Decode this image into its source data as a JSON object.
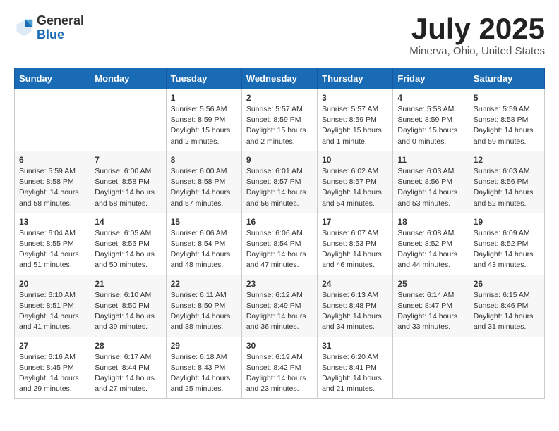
{
  "header": {
    "logo_general": "General",
    "logo_blue": "Blue",
    "month_title": "July 2025",
    "location": "Minerva, Ohio, United States"
  },
  "weekdays": [
    "Sunday",
    "Monday",
    "Tuesday",
    "Wednesday",
    "Thursday",
    "Friday",
    "Saturday"
  ],
  "weeks": [
    [
      {
        "day": "",
        "info": ""
      },
      {
        "day": "",
        "info": ""
      },
      {
        "day": "1",
        "info": "Sunrise: 5:56 AM\nSunset: 8:59 PM\nDaylight: 15 hours and 2 minutes."
      },
      {
        "day": "2",
        "info": "Sunrise: 5:57 AM\nSunset: 8:59 PM\nDaylight: 15 hours and 2 minutes."
      },
      {
        "day": "3",
        "info": "Sunrise: 5:57 AM\nSunset: 8:59 PM\nDaylight: 15 hours and 1 minute."
      },
      {
        "day": "4",
        "info": "Sunrise: 5:58 AM\nSunset: 8:59 PM\nDaylight: 15 hours and 0 minutes."
      },
      {
        "day": "5",
        "info": "Sunrise: 5:59 AM\nSunset: 8:58 PM\nDaylight: 14 hours and 59 minutes."
      }
    ],
    [
      {
        "day": "6",
        "info": "Sunrise: 5:59 AM\nSunset: 8:58 PM\nDaylight: 14 hours and 58 minutes."
      },
      {
        "day": "7",
        "info": "Sunrise: 6:00 AM\nSunset: 8:58 PM\nDaylight: 14 hours and 58 minutes."
      },
      {
        "day": "8",
        "info": "Sunrise: 6:00 AM\nSunset: 8:58 PM\nDaylight: 14 hours and 57 minutes."
      },
      {
        "day": "9",
        "info": "Sunrise: 6:01 AM\nSunset: 8:57 PM\nDaylight: 14 hours and 56 minutes."
      },
      {
        "day": "10",
        "info": "Sunrise: 6:02 AM\nSunset: 8:57 PM\nDaylight: 14 hours and 54 minutes."
      },
      {
        "day": "11",
        "info": "Sunrise: 6:03 AM\nSunset: 8:56 PM\nDaylight: 14 hours and 53 minutes."
      },
      {
        "day": "12",
        "info": "Sunrise: 6:03 AM\nSunset: 8:56 PM\nDaylight: 14 hours and 52 minutes."
      }
    ],
    [
      {
        "day": "13",
        "info": "Sunrise: 6:04 AM\nSunset: 8:55 PM\nDaylight: 14 hours and 51 minutes."
      },
      {
        "day": "14",
        "info": "Sunrise: 6:05 AM\nSunset: 8:55 PM\nDaylight: 14 hours and 50 minutes."
      },
      {
        "day": "15",
        "info": "Sunrise: 6:06 AM\nSunset: 8:54 PM\nDaylight: 14 hours and 48 minutes."
      },
      {
        "day": "16",
        "info": "Sunrise: 6:06 AM\nSunset: 8:54 PM\nDaylight: 14 hours and 47 minutes."
      },
      {
        "day": "17",
        "info": "Sunrise: 6:07 AM\nSunset: 8:53 PM\nDaylight: 14 hours and 46 minutes."
      },
      {
        "day": "18",
        "info": "Sunrise: 6:08 AM\nSunset: 8:52 PM\nDaylight: 14 hours and 44 minutes."
      },
      {
        "day": "19",
        "info": "Sunrise: 6:09 AM\nSunset: 8:52 PM\nDaylight: 14 hours and 43 minutes."
      }
    ],
    [
      {
        "day": "20",
        "info": "Sunrise: 6:10 AM\nSunset: 8:51 PM\nDaylight: 14 hours and 41 minutes."
      },
      {
        "day": "21",
        "info": "Sunrise: 6:10 AM\nSunset: 8:50 PM\nDaylight: 14 hours and 39 minutes."
      },
      {
        "day": "22",
        "info": "Sunrise: 6:11 AM\nSunset: 8:50 PM\nDaylight: 14 hours and 38 minutes."
      },
      {
        "day": "23",
        "info": "Sunrise: 6:12 AM\nSunset: 8:49 PM\nDaylight: 14 hours and 36 minutes."
      },
      {
        "day": "24",
        "info": "Sunrise: 6:13 AM\nSunset: 8:48 PM\nDaylight: 14 hours and 34 minutes."
      },
      {
        "day": "25",
        "info": "Sunrise: 6:14 AM\nSunset: 8:47 PM\nDaylight: 14 hours and 33 minutes."
      },
      {
        "day": "26",
        "info": "Sunrise: 6:15 AM\nSunset: 8:46 PM\nDaylight: 14 hours and 31 minutes."
      }
    ],
    [
      {
        "day": "27",
        "info": "Sunrise: 6:16 AM\nSunset: 8:45 PM\nDaylight: 14 hours and 29 minutes."
      },
      {
        "day": "28",
        "info": "Sunrise: 6:17 AM\nSunset: 8:44 PM\nDaylight: 14 hours and 27 minutes."
      },
      {
        "day": "29",
        "info": "Sunrise: 6:18 AM\nSunset: 8:43 PM\nDaylight: 14 hours and 25 minutes."
      },
      {
        "day": "30",
        "info": "Sunrise: 6:19 AM\nSunset: 8:42 PM\nDaylight: 14 hours and 23 minutes."
      },
      {
        "day": "31",
        "info": "Sunrise: 6:20 AM\nSunset: 8:41 PM\nDaylight: 14 hours and 21 minutes."
      },
      {
        "day": "",
        "info": ""
      },
      {
        "day": "",
        "info": ""
      }
    ]
  ]
}
